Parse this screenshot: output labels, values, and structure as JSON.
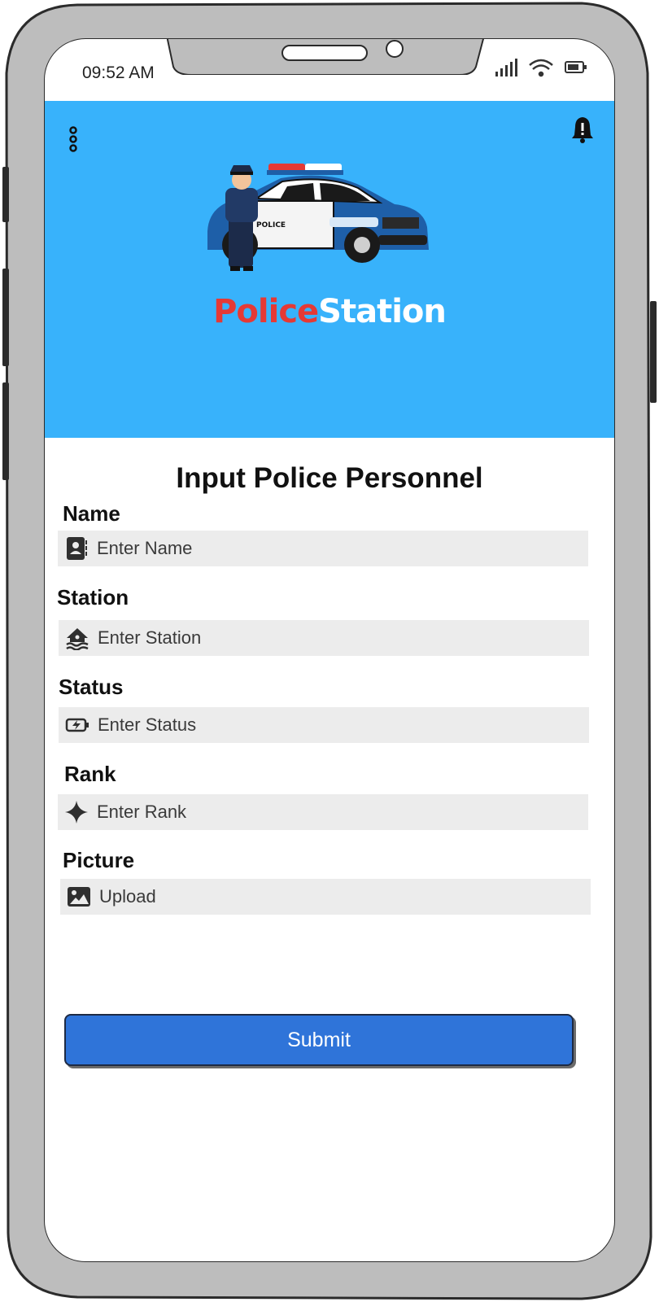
{
  "status_bar": {
    "time": "09:52 AM"
  },
  "header": {
    "background": "#38b2fb",
    "brand_part1": "Police",
    "brand_part2": "Station",
    "brand_color1": "#e53935",
    "menu_icon": "vertical-dots-icon",
    "notification_icon": "bell-alert-icon"
  },
  "form": {
    "title": "Input Police Personnel",
    "fields": [
      {
        "label": "Name",
        "placeholder": "Enter Name",
        "icon": "contact-card-icon"
      },
      {
        "label": "Station",
        "placeholder": "Enter Station",
        "icon": "flooded-house-icon"
      },
      {
        "label": "Status",
        "placeholder": "Enter Status",
        "icon": "battery-charging-icon"
      },
      {
        "label": "Rank",
        "placeholder": "Enter Rank",
        "icon": "sparkle-star-icon"
      },
      {
        "label": "Picture",
        "placeholder": "Upload",
        "icon": "image-icon"
      }
    ],
    "submit_label": "Submit",
    "submit_color": "#2f74d9"
  }
}
